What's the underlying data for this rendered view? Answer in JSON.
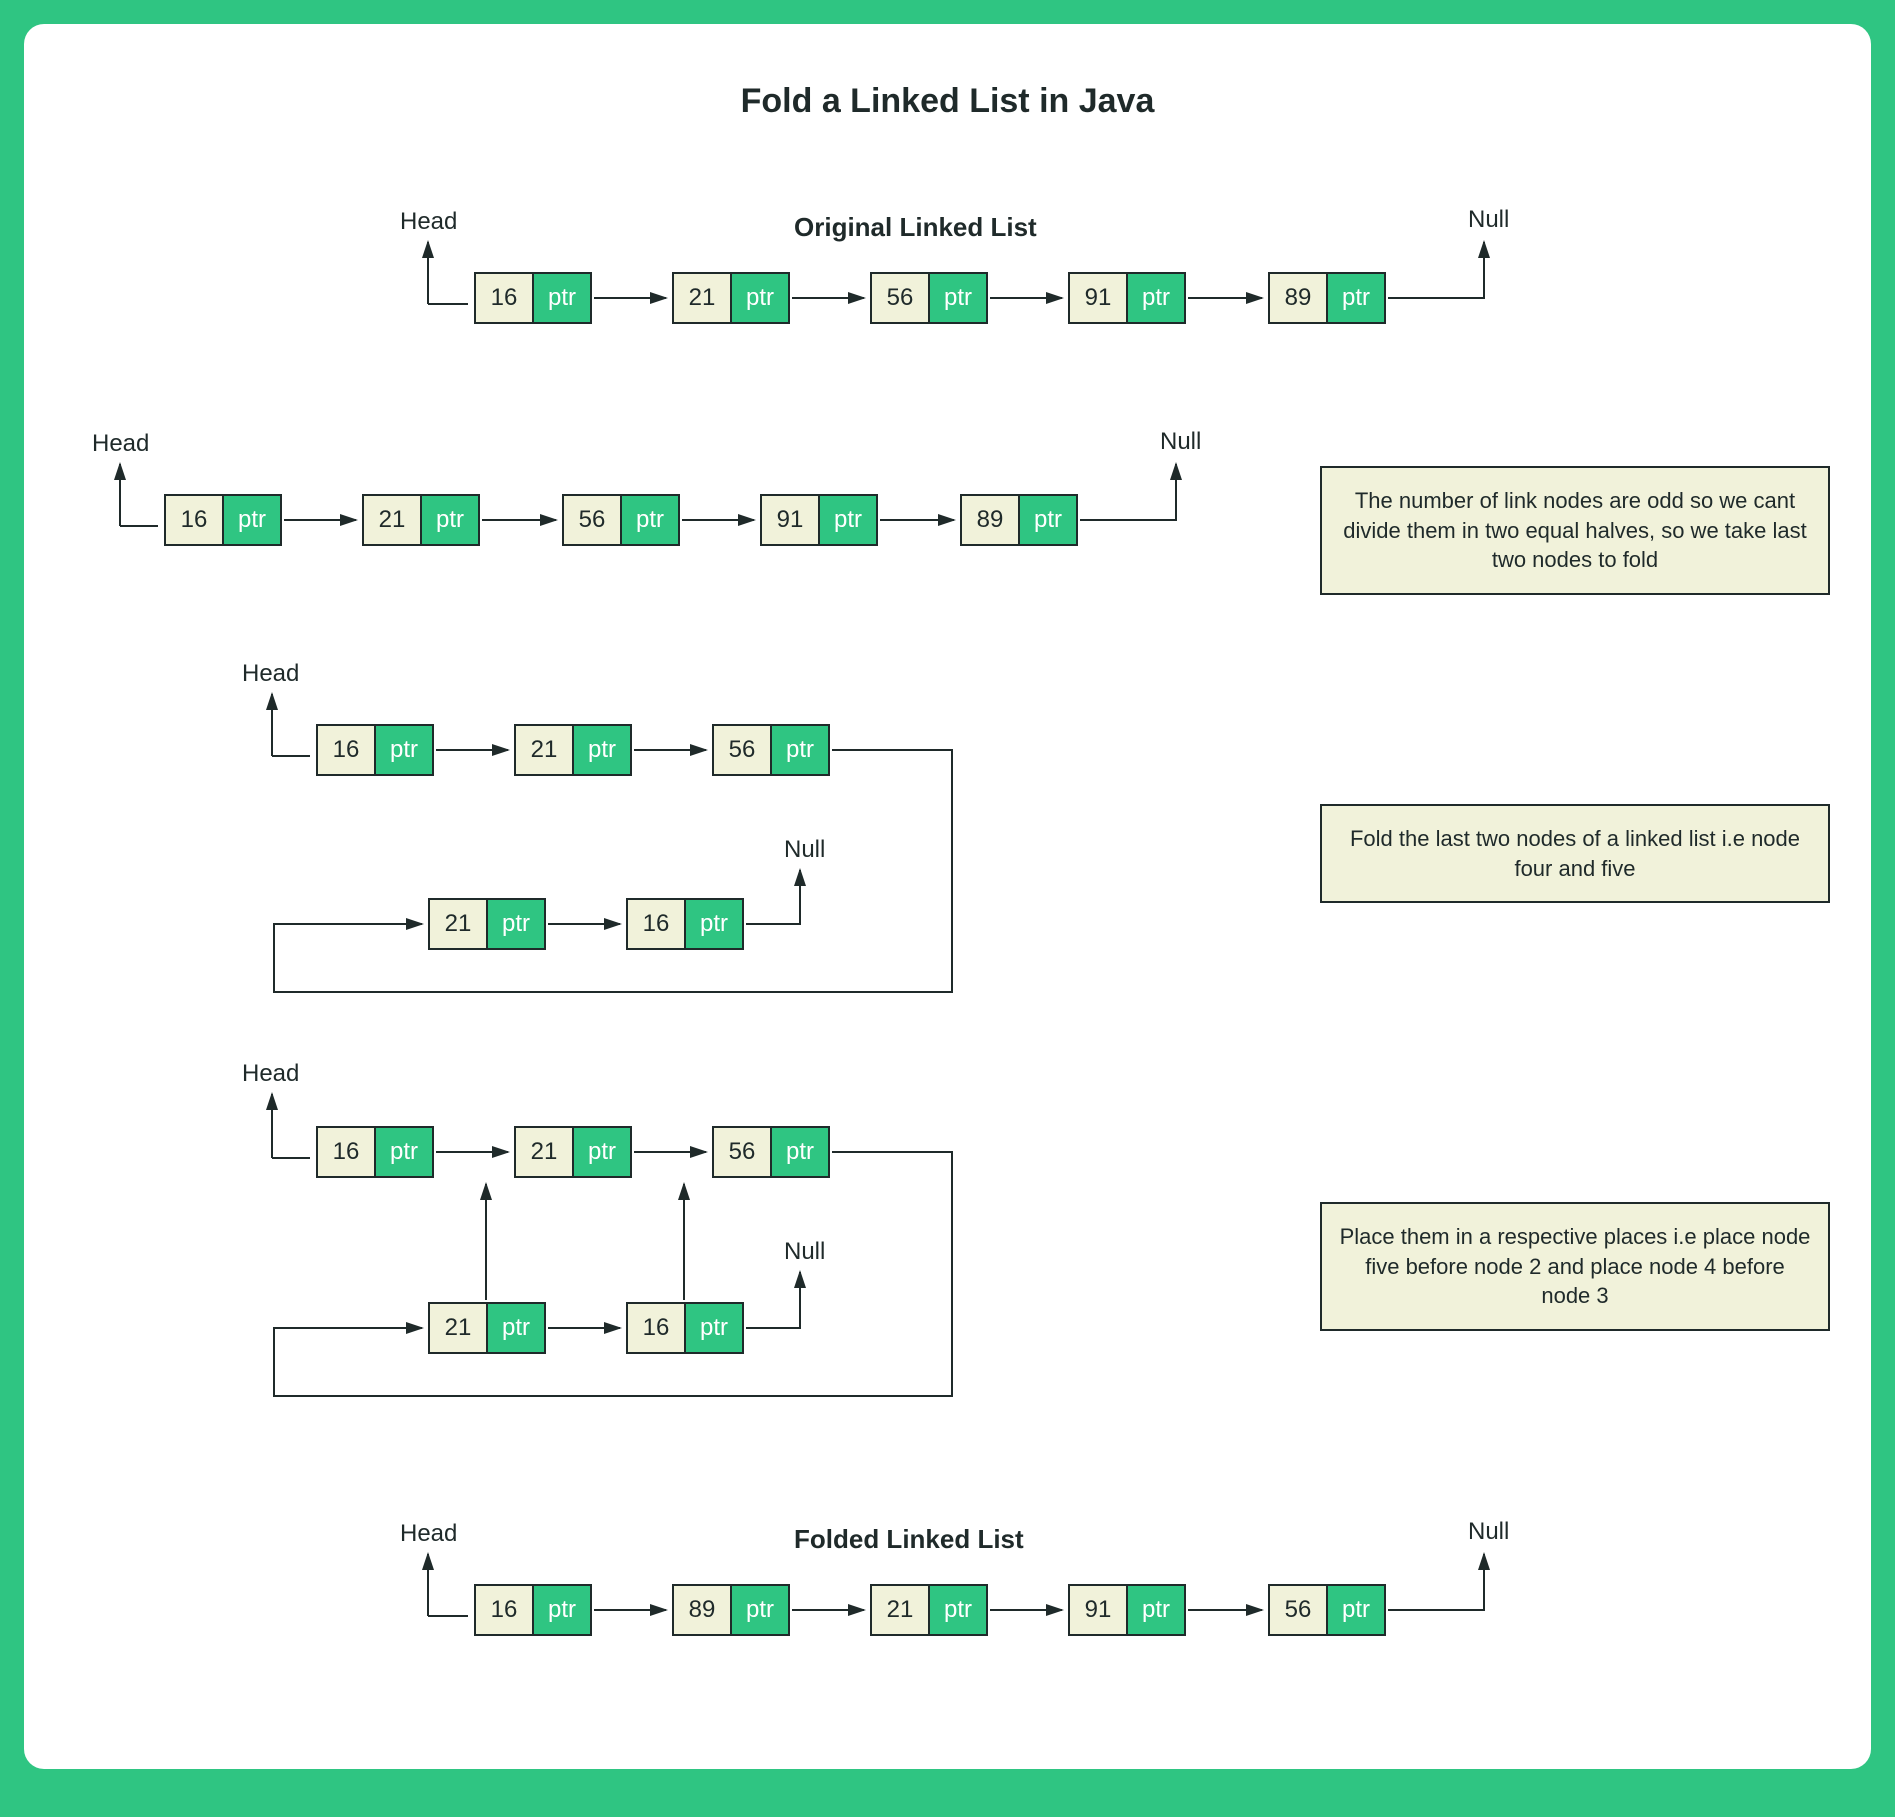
{
  "title": "Fold a Linked List in Java",
  "labels": {
    "head": "Head",
    "null": "Null",
    "ptr": "ptr",
    "original": "Original Linked List",
    "folded": "Folded Linked List"
  },
  "explain": {
    "step1": "The number of link nodes are odd so we cant divide them in two equal halves, so we take last two nodes to fold",
    "step2": "Fold the last two nodes of  a linked list i.e node four and five",
    "step3": "Place them in a respective places i.e place node five before node 2 and place node 4 before node 3"
  },
  "lists": {
    "original": [
      "16",
      "21",
      "56",
      "91",
      "89"
    ],
    "step1": [
      "16",
      "21",
      "56",
      "91",
      "89"
    ],
    "step2_top": [
      "16",
      "21",
      "56"
    ],
    "step2_bot": [
      "21",
      "16"
    ],
    "step3_top": [
      "16",
      "21",
      "56"
    ],
    "step3_bot": [
      "21",
      "16"
    ],
    "folded": [
      "16",
      "89",
      "21",
      "91",
      "56"
    ]
  },
  "colors": {
    "accent": "#2fc582",
    "fill": "#f1f2da",
    "stroke": "#1f2a2a"
  }
}
